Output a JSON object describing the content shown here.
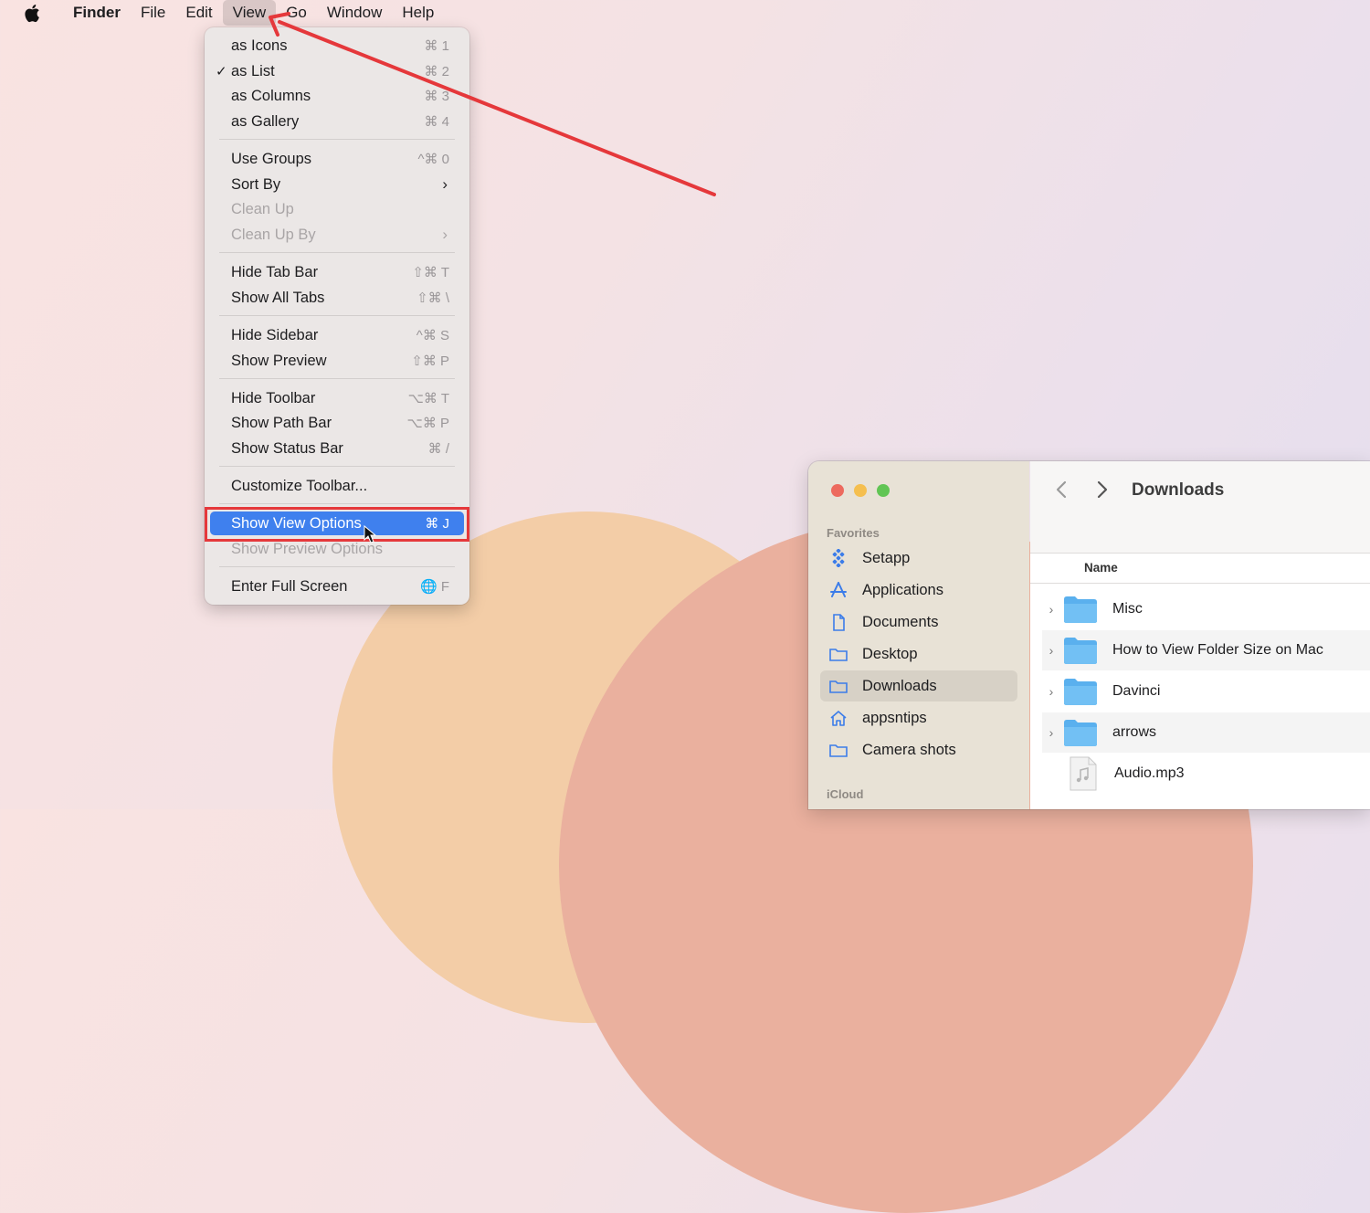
{
  "menubar": {
    "app": "Finder",
    "items": [
      "File",
      "Edit",
      "View",
      "Go",
      "Window",
      "Help"
    ],
    "active": "View"
  },
  "view_menu": {
    "items": [
      {
        "label": "as Icons",
        "shortcut": "⌘ 1"
      },
      {
        "label": "as List",
        "shortcut": "⌘ 2",
        "checked": true
      },
      {
        "label": "as Columns",
        "shortcut": "⌘ 3"
      },
      {
        "label": "as Gallery",
        "shortcut": "⌘ 4"
      },
      {
        "label": "Use Groups",
        "shortcut": "^⌘ 0"
      },
      {
        "label": "Sort By",
        "submenu": true
      },
      {
        "label": "Clean Up",
        "disabled": true
      },
      {
        "label": "Clean Up By",
        "disabled": true,
        "submenu": true
      },
      {
        "label": "Hide Tab Bar",
        "shortcut": "⇧⌘ T"
      },
      {
        "label": "Show All Tabs",
        "shortcut": "⇧⌘ \\"
      },
      {
        "label": "Hide Sidebar",
        "shortcut": "^⌘ S"
      },
      {
        "label": "Show Preview",
        "shortcut": "⇧⌘ P"
      },
      {
        "label": "Hide Toolbar",
        "shortcut": "⌥⌘ T"
      },
      {
        "label": "Show Path Bar",
        "shortcut": "⌥⌘ P"
      },
      {
        "label": "Show Status Bar",
        "shortcut": "⌘ /"
      },
      {
        "label": "Customize Toolbar..."
      },
      {
        "label": "Show View Options",
        "shortcut": "⌘ J",
        "highlighted": true
      },
      {
        "label": "Show Preview Options",
        "disabled": true
      },
      {
        "label": "Enter Full Screen",
        "shortcut": "🌐 F"
      }
    ]
  },
  "finder": {
    "title": "Downloads",
    "sidebar": {
      "favorites_label": "Favorites",
      "icloud_label": "iCloud",
      "items": [
        {
          "label": "Setapp",
          "icon": "setapp-icon"
        },
        {
          "label": "Applications",
          "icon": "applications-icon"
        },
        {
          "label": "Documents",
          "icon": "document-icon"
        },
        {
          "label": "Desktop",
          "icon": "folder-icon"
        },
        {
          "label": "Downloads",
          "icon": "folder-icon",
          "selected": true
        },
        {
          "label": "appsntips",
          "icon": "home-icon"
        },
        {
          "label": "Camera shots",
          "icon": "folder-icon"
        }
      ]
    },
    "column_header": "Name",
    "files": [
      {
        "name": "Misc",
        "type": "folder"
      },
      {
        "name": "How to View Folder Size on Mac",
        "type": "folder"
      },
      {
        "name": "Davinci",
        "type": "folder"
      },
      {
        "name": "arrows",
        "type": "folder"
      },
      {
        "name": "Audio.mp3",
        "type": "audio"
      }
    ]
  },
  "colors": {
    "highlight": "#3f80ee",
    "annotation_red": "#e5383b",
    "close": "#ed6a5e",
    "minimize": "#f5bf4f",
    "zoom": "#61c554"
  }
}
